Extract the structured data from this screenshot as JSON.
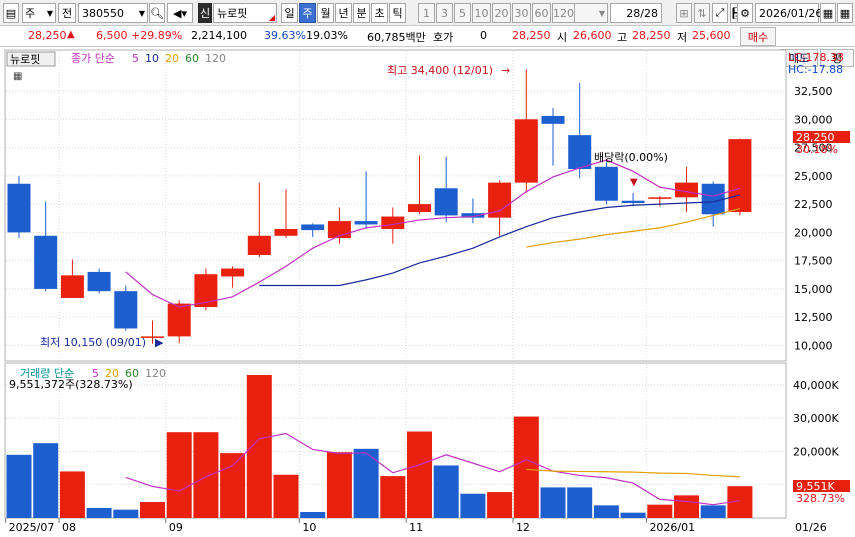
{
  "toolbar": {
    "type_label": "주",
    "market_label": "전",
    "stock_code": "380550",
    "stock_badge": "신",
    "stock_name": "뉴로핏",
    "period_buttons": [
      "일",
      "주",
      "월",
      "년",
      "분",
      "초",
      "틱"
    ],
    "selected_period": "주",
    "interval_buttons": [
      "1",
      "3",
      "5",
      "10",
      "20",
      "30",
      "60",
      "120"
    ],
    "page_counter": "28/28",
    "date_value": "2026/01/26"
  },
  "quote": {
    "price": "28,250",
    "change": "6,500",
    "change_pct": "+29.89%",
    "volume": "2,214,100",
    "turnover_pct": "39.63%",
    "ratio": "19.03%",
    "amount": "60,785백만",
    "hoga_label": "호가",
    "hoga_value": "0",
    "bid_price": "28,250",
    "open_label": "시",
    "open_value": "26,600",
    "high_label": "고",
    "high_value": "28,250",
    "low_label": "저",
    "low_value": "25,600",
    "buy_label": "매수",
    "sell_label": "매도",
    "eval_label": "평"
  },
  "chart_data": [
    {
      "type": "candlestick",
      "title": "뉴로핏",
      "legend": "종가 단순 5 10 20 60 120",
      "legend_items": [
        "종가 단순",
        "5",
        "10",
        "20",
        "60",
        "120"
      ],
      "legend_colors": [
        "#c030c0",
        "#c030c0",
        "#1a2a9a",
        "#e0a000",
        "#2a8a2a",
        "#888888"
      ],
      "y_ticks": [
        10000,
        12500,
        15000,
        17500,
        20000,
        22500,
        25000,
        27500,
        30000,
        32500
      ],
      "y_tick_labels": [
        "10,000",
        "12,500",
        "15,000",
        "17,500",
        "20,000",
        "22,500",
        "25,000",
        "27,500",
        "30,000",
        "32,500"
      ],
      "ylim": [
        8800,
        35600
      ],
      "lc_label": "LC:178.33",
      "hc_label": "HC:-17.88",
      "last_price_label": "28,250",
      "last_pct_label": "30.18%",
      "annotations": {
        "high": "최고 34,400 (12/01)",
        "low": "최저 10,150 (09/01)",
        "dividend": "배당락(0.00%)"
      },
      "candles": [
        {
          "o": 24300,
          "h": 25000,
          "l": 19500,
          "c": 20000
        },
        {
          "o": 19700,
          "h": 22700,
          "l": 14800,
          "c": 15000
        },
        {
          "o": 14200,
          "h": 17600,
          "l": 14200,
          "c": 16200
        },
        {
          "o": 16500,
          "h": 16800,
          "l": 14600,
          "c": 14800
        },
        {
          "o": 14800,
          "h": 15300,
          "l": 11300,
          "c": 11500
        },
        {
          "o": 10700,
          "h": 12200,
          "l": 10150,
          "c": 10800
        },
        {
          "o": 10800,
          "h": 14000,
          "l": 10200,
          "c": 13700
        },
        {
          "o": 13400,
          "h": 16800,
          "l": 13100,
          "c": 16300
        },
        {
          "o": 16100,
          "h": 17000,
          "l": 15100,
          "c": 16800
        },
        {
          "o": 18000,
          "h": 24400,
          "l": 17800,
          "c": 19700
        },
        {
          "o": 19700,
          "h": 23800,
          "l": 19500,
          "c": 20300
        },
        {
          "o": 20700,
          "h": 20800,
          "l": 19600,
          "c": 20200
        },
        {
          "o": 19500,
          "h": 22200,
          "l": 19000,
          "c": 21000
        },
        {
          "o": 21000,
          "h": 25400,
          "l": 20300,
          "c": 20700
        },
        {
          "o": 20300,
          "h": 22200,
          "l": 19000,
          "c": 21400
        },
        {
          "o": 21800,
          "h": 26800,
          "l": 21600,
          "c": 22500
        },
        {
          "o": 23900,
          "h": 26700,
          "l": 20900,
          "c": 21500
        },
        {
          "o": 21700,
          "h": 23000,
          "l": 20800,
          "c": 21300
        },
        {
          "o": 21300,
          "h": 24600,
          "l": 19700,
          "c": 24400
        },
        {
          "o": 24400,
          "h": 34400,
          "l": 23500,
          "c": 30000
        },
        {
          "o": 30300,
          "h": 31000,
          "l": 25900,
          "c": 29600
        },
        {
          "o": 28600,
          "h": 33200,
          "l": 24800,
          "c": 25600
        },
        {
          "o": 25800,
          "h": 26200,
          "l": 22500,
          "c": 22800
        },
        {
          "o": 22800,
          "h": 23500,
          "l": 22300,
          "c": 22600
        },
        {
          "o": 23000,
          "h": 23200,
          "l": 22300,
          "c": 23100
        },
        {
          "o": 23100,
          "h": 25800,
          "l": 21800,
          "c": 24400
        },
        {
          "o": 24300,
          "h": 24500,
          "l": 20500,
          "c": 21600
        },
        {
          "o": 21800,
          "h": 28300,
          "l": 21500,
          "c": 28250
        }
      ],
      "ma5": [
        null,
        null,
        null,
        null,
        16500,
        14500,
        13400,
        13800,
        14300,
        15600,
        17000,
        18600,
        19700,
        20400,
        20700,
        21100,
        21300,
        21400,
        21900,
        23600,
        24900,
        25700,
        26400,
        25400,
        24000,
        23600,
        23200,
        23900
      ],
      "ma10": [
        null,
        null,
        null,
        null,
        null,
        null,
        null,
        null,
        null,
        15300,
        15300,
        15300,
        15300,
        15800,
        16400,
        17300,
        17900,
        18600,
        19600,
        20500,
        21300,
        21800,
        22200,
        22400,
        22500,
        22600,
        22700,
        23300
      ],
      "ma20": [
        null,
        null,
        null,
        null,
        null,
        null,
        null,
        null,
        null,
        null,
        null,
        null,
        null,
        null,
        null,
        null,
        null,
        null,
        null,
        18700,
        19100,
        19400,
        19800,
        20100,
        20400,
        20900,
        21500,
        22100
      ]
    },
    {
      "type": "bar",
      "title": "거래량",
      "legend": "거래량 단순 5 20 60 120",
      "legend_items": [
        "거래량 단순",
        "5",
        "20",
        "60",
        "120"
      ],
      "legend_colors": [
        "#009090",
        "#c030c0",
        "#e0a000",
        "#2a8a2a",
        "#888888"
      ],
      "value_label": "9,551,372주(328.73%)",
      "y_ticks": [
        10000,
        20000,
        30000,
        40000
      ],
      "y_tick_labels": [
        "10,000K",
        "20,000K",
        "30,000K",
        "40,000K"
      ],
      "ylim": [
        0,
        46000
      ],
      "last_value_label": "9,551K",
      "last_pct_label": "328.73%",
      "volumes": [
        19000,
        22500,
        14000,
        3000,
        2500,
        4800,
        25800,
        25800,
        19500,
        43000,
        13000,
        1800,
        19800,
        20800,
        12600,
        26000,
        15800,
        7300,
        7800,
        30500,
        9200,
        9200,
        3800,
        1600,
        4000,
        6800,
        3800,
        9551
      ],
      "vma5": [
        null,
        null,
        null,
        null,
        12200,
        9500,
        8100,
        12400,
        15700,
        23800,
        25400,
        20600,
        19400,
        19600,
        13600,
        16000,
        19000,
        16500,
        13900,
        17500,
        14100,
        12800,
        12100,
        10500,
        5600,
        5000,
        4000,
        5200
      ],
      "vma20": [
        null,
        null,
        null,
        null,
        null,
        null,
        null,
        null,
        null,
        null,
        null,
        null,
        null,
        null,
        null,
        null,
        null,
        null,
        null,
        14600,
        14100,
        14000,
        13900,
        13800,
        13500,
        13400,
        12800,
        12400
      ]
    }
  ],
  "x_axis": [
    {
      "label": "2025/07",
      "index": 0
    },
    {
      "label": "08",
      "index": 2
    },
    {
      "label": "09",
      "index": 6
    },
    {
      "label": "10",
      "index": 11
    },
    {
      "label": "11",
      "index": 15
    },
    {
      "label": "12",
      "index": 19
    },
    {
      "label": "2026/01",
      "index": 24
    }
  ],
  "x_axis_right_label": "01/26",
  "colors": {
    "up": "#e8200e",
    "down": "#1e5fd0",
    "ma5": "#c030c0",
    "ma10": "#1a2a9a",
    "ma20": "#e0a000",
    "grid": "#d8d8d8"
  }
}
